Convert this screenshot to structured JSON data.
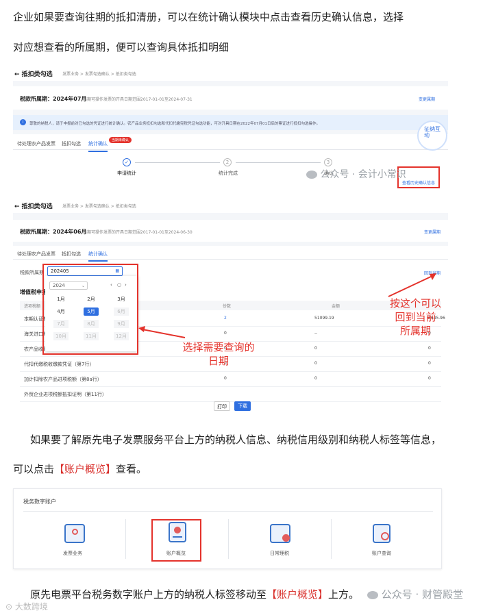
{
  "article": {
    "para1_line1": "企业如果要查询往期的抵扣清册，可以在统计确认模块中点击查看历史确认信息，选择",
    "para1_line2": "对应想查看的所属期，便可以查询具体抵扣明细",
    "para2_line1": "如果要了解原先电子发票服务平台上方的纳税人信息、纳税信用级别和纳税人标签等信息，",
    "para2_line2_pre": "可以点击",
    "para2_line2_red": "【账户概览】",
    "para2_line2_post": "查看。",
    "para3_pre": "原先电票平台税务数字账户上方的纳税人标签移动至",
    "para3_red": "【账户概览】",
    "para3_post": "上方。"
  },
  "screen1": {
    "back_label": "← 抵扣类勾选",
    "breadcrumb": [
      "发票业务",
      "发票勾选确认",
      "抵扣类勾选"
    ],
    "period_label": "税款所属期：2024年07月",
    "period_range": "当期可操作发票的开具日期范围2017-01-01至2024-07-31",
    "change_period": "变更属期",
    "notice": "尊敬的纳税人，请于申报前对已勾选的凭证进行统计确认。农产品业务抵扣勾选和代扣代缴完税凭证勾选功能，可对开具日期在2022年07月01日后的票证进行抵扣勾选操作。",
    "tabs": [
      "待处理农产品发票",
      "抵扣勾选",
      "统计确认"
    ],
    "badge": "当期未确认",
    "steps": [
      {
        "label": "申请统计",
        "marker": "✓"
      },
      {
        "label": "统计完成",
        "marker": "2"
      },
      {
        "label": "确认",
        "marker": "3"
      }
    ],
    "history_link": "查看历史确认信息",
    "mascot_text": "征纳互动"
  },
  "screen2": {
    "back_label": "← 抵扣类勾选",
    "breadcrumb": [
      "发票业务",
      "发票勾选确认",
      "抵扣类勾选"
    ],
    "period_label": "税款所属期：2024年06月",
    "period_range": "当期可操作发票的开具日期范围2017-01-01至2024-06-30",
    "change_period": "变更属期",
    "tabs": [
      "待处理农产品发票",
      "抵扣勾选",
      "统计确认"
    ],
    "query_label": "税款所属期",
    "query_value": "202405",
    "back_current": "回到当期",
    "section_title": "增值税申报",
    "col_type": "进项税额",
    "col_count": "份数",
    "col_amount": "金额",
    "year_value": "2024",
    "months": [
      "1月",
      "2月",
      "3月",
      "4月",
      "5月",
      "6月",
      "7月",
      "8月",
      "9月",
      "10月",
      "11月",
      "12月"
    ],
    "rows": [
      {
        "name": "本期认证相",
        "count": "2",
        "amount": "51099.19",
        "tax": "6645.96"
      },
      {
        "name": "海关进口增",
        "count": "0",
        "amount": "--",
        "tax": "0"
      },
      {
        "name": "农产品收购发票或者销售发票（第6行）",
        "count": "0",
        "amount": "0",
        "tax": "0"
      },
      {
        "name": "代扣代缴税收缴款凭证（第7行）",
        "count": "0",
        "amount": "0",
        "tax": "0"
      },
      {
        "name": "加计扣除农产品进项税额（第8a行）",
        "count": "0",
        "amount": "0",
        "tax": "0"
      },
      {
        "name": "外贸企业进项税额抵扣证明（第11行）",
        "count": "",
        "amount": "",
        "tax": ""
      }
    ],
    "print_button": "打印",
    "download_button": "下载",
    "annot_select": "选择需要查询的\n日期",
    "annot_back": "按这个可以\n回到当前\n所属期"
  },
  "screen3": {
    "title": "税务数字账户",
    "tiles": [
      "发票业务",
      "账户概览",
      "日常理税",
      "账户查询"
    ]
  },
  "watermarks": {
    "w1": "公众号 · 会计小常识",
    "w2": "公众号 · 财管殿堂",
    "w3": "大数跨境"
  },
  "colors": {
    "accent": "#2f6fe0",
    "annotation": "#e4322b",
    "notice_bg": "#e6f0fd"
  }
}
